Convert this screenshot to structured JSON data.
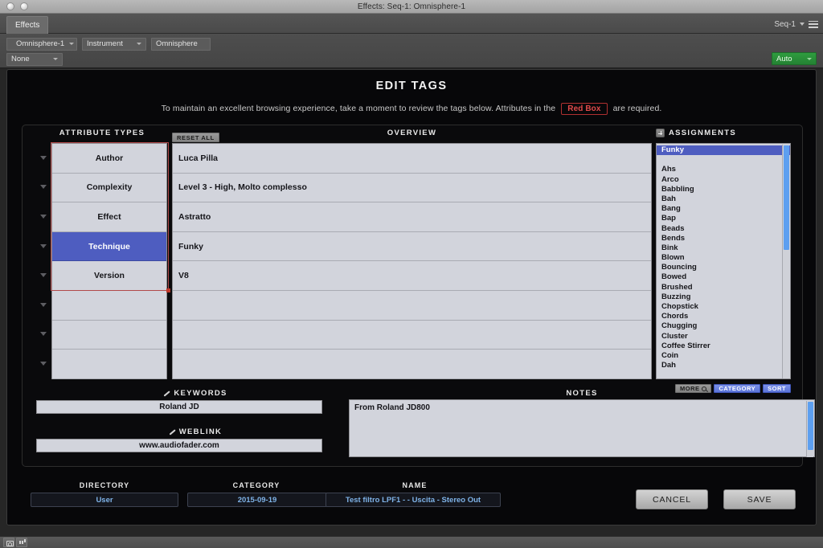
{
  "window": {
    "title": "Effects: Seq-1: Omnisphere-1",
    "traffic_lights": [
      "close-button",
      "minimize-button"
    ]
  },
  "tabstrip": {
    "tab_label": "Effects",
    "preset_selector": "Seq-1",
    "menu_icon": "hamburger-menu-icon"
  },
  "toolbar": {
    "slot_name": "Omnisphere-1",
    "slot_type": "Instrument",
    "plugin_name": "Omnisphere",
    "preset": "None",
    "automation": "Auto"
  },
  "dialog": {
    "title": "EDIT TAGS",
    "subtitle_before": "To maintain an excellent browsing experience, take a moment to review the tags below.  Attributes in the",
    "subtitle_badge": "Red Box",
    "subtitle_after": "are required."
  },
  "attribute_types": {
    "heading": "ATTRIBUTE TYPES",
    "rows": [
      {
        "label": "Author",
        "selected": false
      },
      {
        "label": "Complexity",
        "selected": false
      },
      {
        "label": "Effect",
        "selected": false
      },
      {
        "label": "Technique",
        "selected": true
      },
      {
        "label": "Version",
        "selected": false
      },
      {
        "label": "",
        "selected": false
      },
      {
        "label": "",
        "selected": false
      },
      {
        "label": "",
        "selected": false
      }
    ]
  },
  "overview": {
    "heading": "OVERVIEW",
    "reset_all": "RESET ALL",
    "rows": [
      "Luca Pilla",
      "Level 3 - High, Molto complesso",
      "Astratto",
      "Funky",
      "V8",
      "",
      "",
      ""
    ]
  },
  "assignments": {
    "heading": "ASSIGNMENTS",
    "add_icon": "plus-icon",
    "selected": "Funky",
    "items": [
      "Ahs",
      "Arco",
      "Babbling",
      "Bah",
      "Bang",
      "Bap",
      "Beads",
      "Bends",
      "Bink",
      "Blown",
      "Bouncing",
      "Bowed",
      "Brushed",
      "Buzzing",
      "Chopstick",
      "Chords",
      "Chugging",
      "Cluster",
      "Coffee Stirrer",
      "Coin",
      "Dah"
    ],
    "buttons": [
      {
        "label": "MORE",
        "style": "grey",
        "icon": "search-icon"
      },
      {
        "label": "CATEGORY",
        "style": "blue",
        "icon": ""
      },
      {
        "label": "SORT",
        "style": "blue",
        "icon": ""
      }
    ]
  },
  "keywords": {
    "heading": "KEYWORDS",
    "edit_icon": "pencil-icon",
    "value": "Roland JD"
  },
  "weblink": {
    "heading": "WEBLINK",
    "edit_icon": "pencil-icon",
    "value": "www.audiofader.com"
  },
  "notes": {
    "heading": "NOTES",
    "value": "From Roland JD800"
  },
  "footer": {
    "directory_label": "DIRECTORY",
    "directory_value": "User",
    "category_label": "CATEGORY",
    "category_value": "2015-09-19",
    "name_label": "NAME",
    "name_value": "Test filtro LPF1 -  - Uscita - Stereo Out",
    "cancel_label": "CANCEL",
    "save_label": "SAVE"
  },
  "statusbar": {
    "icons": [
      "camera-icon",
      "meter-icon"
    ]
  },
  "colors": {
    "selection_blue": "#4e5dc0",
    "required_red": "#b03030",
    "auto_green": "#2f9c3f",
    "panel_light": "#d2d4dc",
    "link_blue": "#7fb3e8"
  }
}
